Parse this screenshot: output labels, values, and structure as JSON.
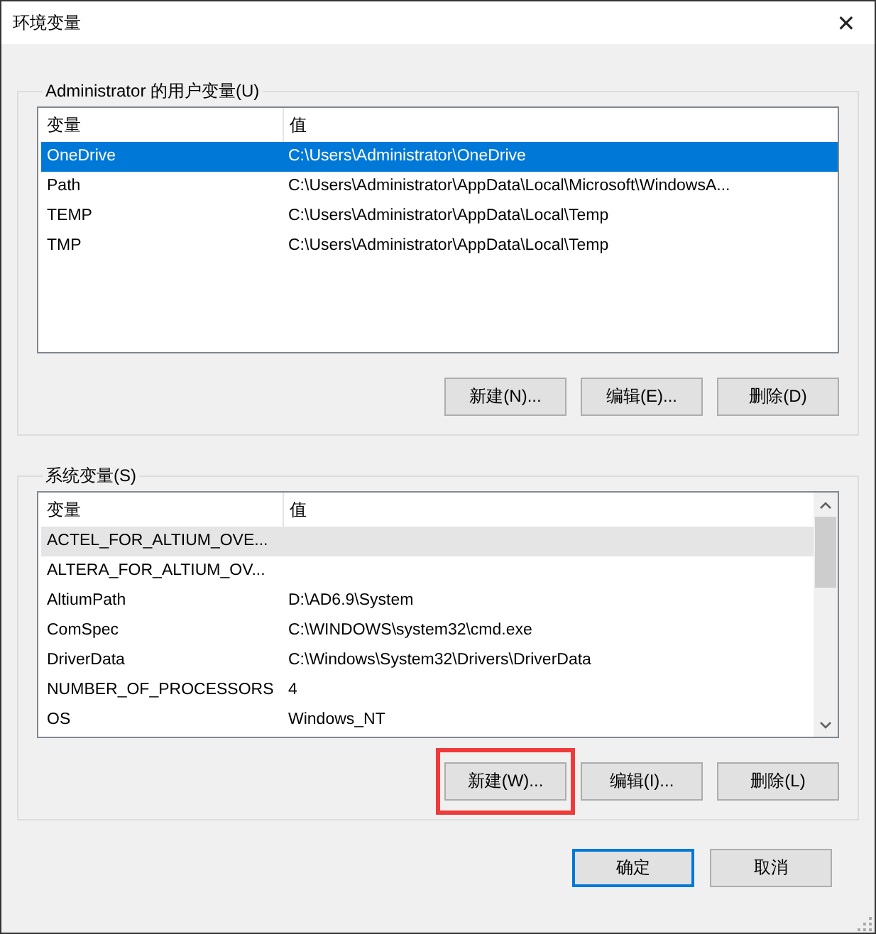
{
  "window": {
    "title": "环境变量",
    "close": "✕"
  },
  "user_vars": {
    "label": "Administrator 的用户变量(U)",
    "focused": true,
    "columns": [
      "变量",
      "值"
    ],
    "rows": [
      {
        "name": "OneDrive",
        "value": "C:\\Users\\Administrator\\OneDrive",
        "selected": true
      },
      {
        "name": "Path",
        "value": "C:\\Users\\Administrator\\AppData\\Local\\Microsoft\\WindowsA...",
        "selected": false
      },
      {
        "name": "TEMP",
        "value": "C:\\Users\\Administrator\\AppData\\Local\\Temp",
        "selected": false
      },
      {
        "name": "TMP",
        "value": "C:\\Users\\Administrator\\AppData\\Local\\Temp",
        "selected": false
      }
    ],
    "buttons": [
      "新建(N)...",
      "编辑(E)...",
      "删除(D)"
    ]
  },
  "system_vars": {
    "label": "系统变量(S)",
    "focused": false,
    "columns": [
      "变量",
      "值"
    ],
    "rows": [
      {
        "name": "ACTEL_FOR_ALTIUM_OVE...",
        "selected": true
      },
      {
        "name": "ALTERA_FOR_ALTIUM_OV...",
        "selected": false
      },
      {
        "name": "AltiumPath",
        "value": "D:\\AD6.9\\System",
        "selected": false
      },
      {
        "name": "ComSpec",
        "value": "C:\\WINDOWS\\system32\\cmd.exe",
        "selected": false
      },
      {
        "name": "DriverData",
        "value": "C:\\Windows\\System32\\Drivers\\DriverData",
        "selected": false
      },
      {
        "name": "NUMBER_OF_PROCESSORS",
        "value": "4",
        "selected": false
      },
      {
        "name": "OS",
        "value": "Windows_NT",
        "selected": false
      }
    ],
    "buttons": [
      "新建(W)...",
      "编辑(I)...",
      "删除(L)"
    ],
    "button_highlights": [
      {
        "highlighted": true
      },
      {
        "highlighted": false
      },
      {
        "highlighted": false
      }
    ]
  },
  "dialog_buttons": [
    {
      "label": "确定",
      "default": true
    },
    {
      "label": "取消",
      "default": false
    }
  ]
}
